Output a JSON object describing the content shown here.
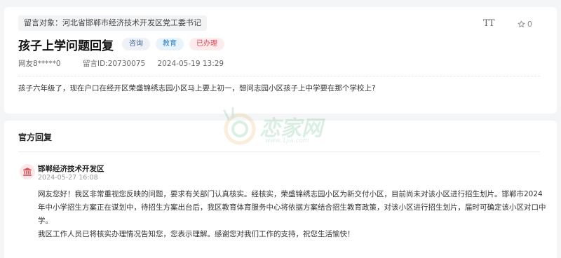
{
  "question": {
    "target_label": "留言对象：河北省邯郸市经济技术开发区党工委书记",
    "title": "孩子上学问题回复",
    "tags": [
      "咨询",
      "教育",
      "已办理"
    ],
    "user": "网友8*****0",
    "message_id": "留言ID:20730075",
    "time": "2024-05-19 13:29",
    "content": "孩子六年级了，现在户口在经开区荣盛锦绣志园小区马上要上初一，想问志园小区孩子上中学要在那个学校上?"
  },
  "toolbar": {
    "font_size_label": "TT",
    "fav_count": "0"
  },
  "reply": {
    "heading": "官方回复",
    "department": "邯郸经济技术开发区",
    "time": "2024-05-27 16:08",
    "paragraphs": [
      "网友您好！我区非常重视您反映的问题，要求有关部门认真核实。经核实，荣盛锦绣志园小区为新交付小区，目前尚未对该小区进行招生划片。邯郸市2024年中小学招生方案正在谋划中，待招生方案出台后，我区教育体育服务中心将依据方案结合招生教育政策，对该小区进行招生划片，届时可确定该小区对口中学。",
      "我区工作人员已将核实办理情况告知您，您表示理解。感谢您对我们工作的支持，祝您生活愉快！"
    ]
  },
  "watermark": {
    "text": "恋家网",
    "url": "www.1jia.com"
  },
  "colors": {
    "accent_red": "#e0434f",
    "tag_blue": "#2b82c9",
    "watermark_green": "#3aa66a"
  }
}
